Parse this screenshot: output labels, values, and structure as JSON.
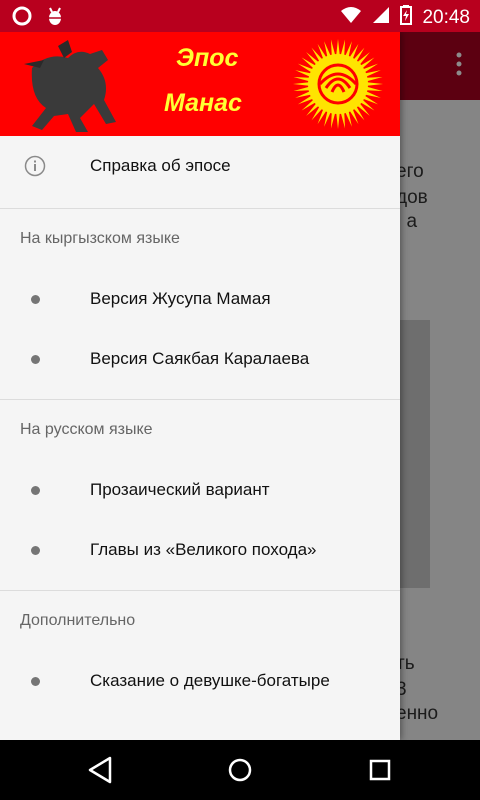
{
  "status_bar": {
    "time": "20:48",
    "left_icons": [
      "opera-icon",
      "android-debug-icon"
    ],
    "right_icons": [
      "wifi-icon",
      "signal-icon",
      "battery-charging-icon"
    ]
  },
  "drawer": {
    "header": {
      "title_line1": "Эпос",
      "title_line2": "Манас",
      "background_color": "#ff0000",
      "title_color": "#ffff33"
    },
    "top_item": {
      "label": "Справка об эпосе",
      "icon": "info-icon"
    },
    "sections": [
      {
        "header": "На кыргызском языке",
        "items": [
          "Версия Жусупа Мамая",
          "Версия Саякбая Каралаева"
        ]
      },
      {
        "header": "На русском языке",
        "items": [
          "Прозаический вариант",
          "Главы из «Великого похода»"
        ]
      },
      {
        "header": "Дополнительно",
        "items": [
          "Сказание о девушке-богатыре"
        ]
      }
    ]
  },
  "background": {
    "text_fragments_top": [
      "его",
      "дов",
      ", а"
    ],
    "text_fragments_bottom": [
      "ть",
      "3",
      "енно"
    ]
  },
  "nav_bar": {
    "buttons": [
      "back-icon",
      "home-icon",
      "recents-icon"
    ]
  }
}
